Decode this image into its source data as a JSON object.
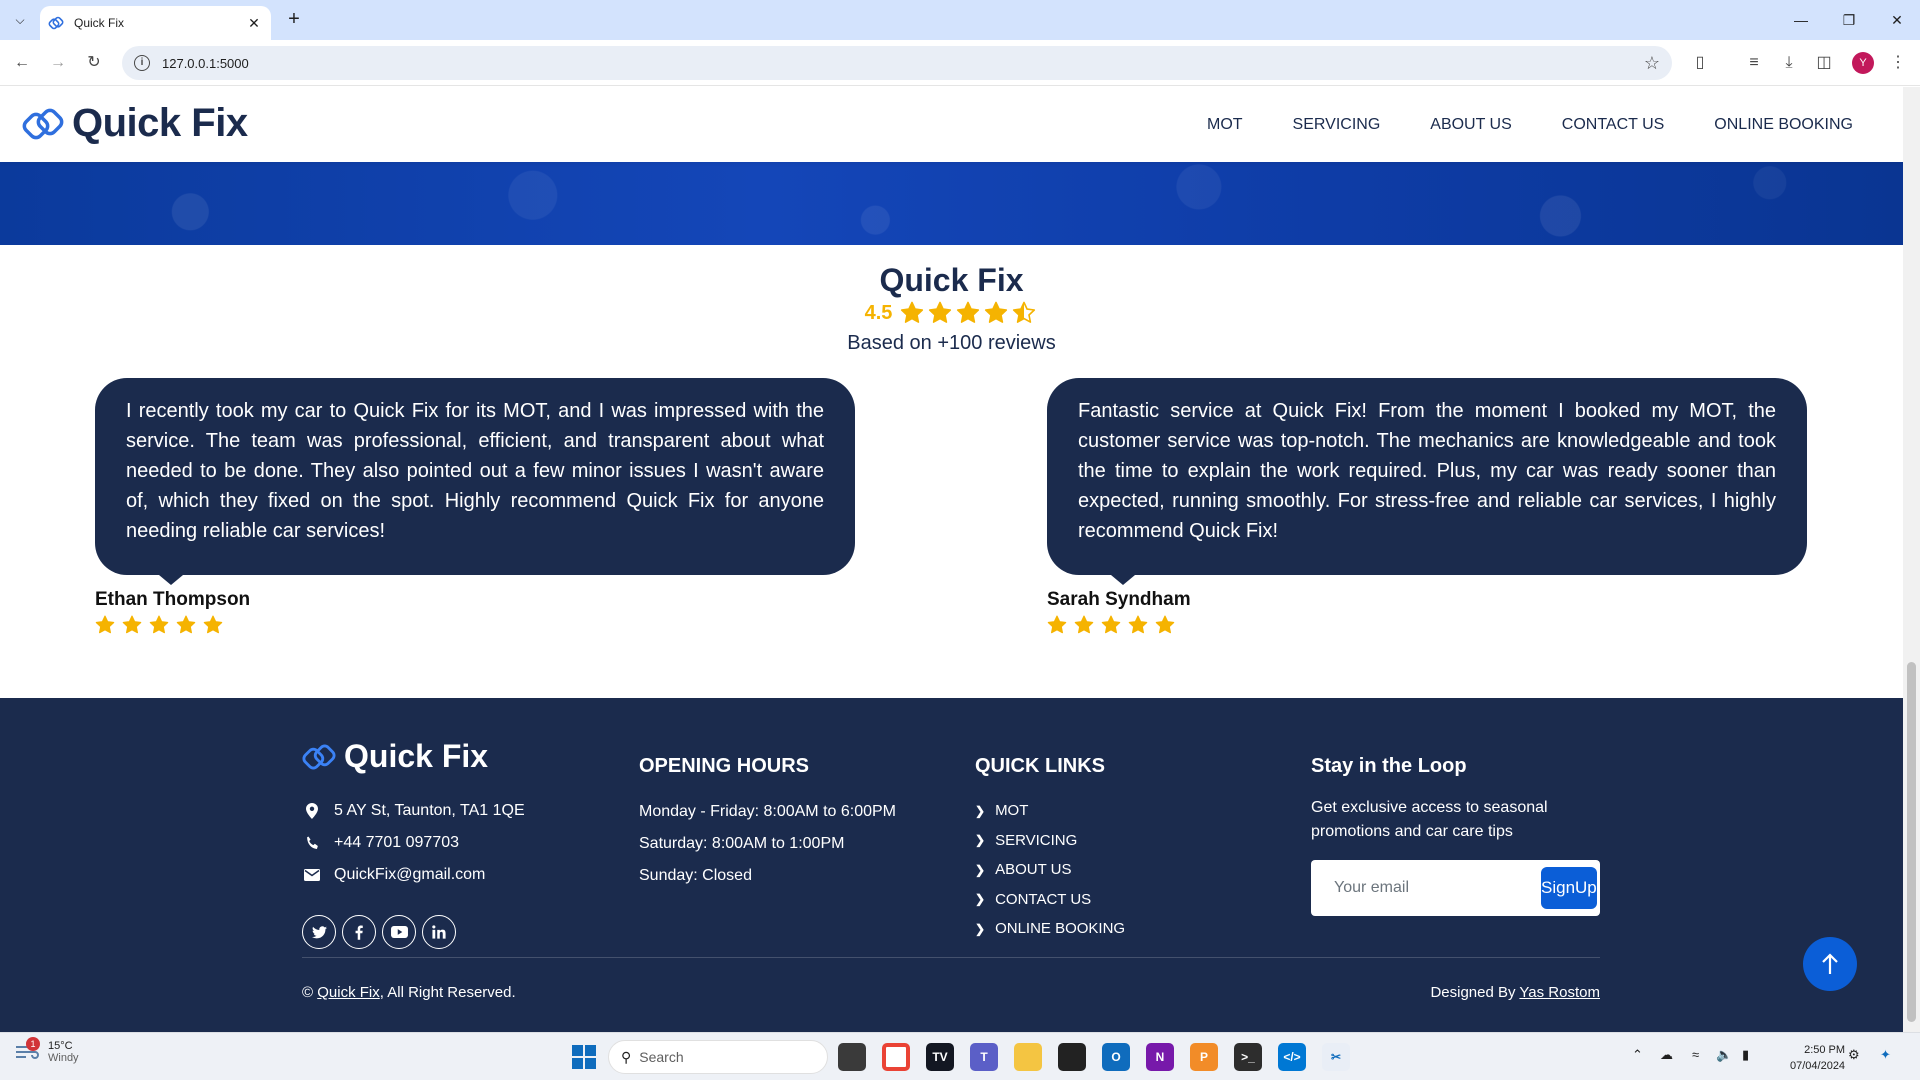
{
  "browser": {
    "tab_title": "Quick Fix",
    "url": "127.0.0.1:5000",
    "avatar_letter": "Y"
  },
  "navbar": {
    "brand": "Quick Fix",
    "links": [
      "MOT",
      "SERVICING",
      "ABOUT US",
      "CONTACT US",
      "ONLINE BOOKING"
    ]
  },
  "reviews": {
    "title": "Quick Fix",
    "rating": "4.5",
    "rating_value": 4.5,
    "rating_max": 5,
    "count_text": "Based on +100 reviews",
    "items": [
      {
        "text": "I recently took my car to Quick Fix for its MOT, and I was impressed with the service. The team was professional, efficient, and transparent about what needed to be done. They also pointed out a few minor issues I wasn't aware of, which they fixed on the spot. Highly recommend Quick Fix for anyone needing reliable car services!",
        "name": "Ethan Thompson",
        "stars": 5
      },
      {
        "text": "Fantastic service at Quick Fix! From the moment I booked my MOT, the customer service was top-notch. The mechanics are knowledgeable and took the time to explain the work required. Plus, my car was ready sooner than expected, running smoothly. For stress-free and reliable car services, I highly recommend Quick Fix!",
        "name": "Sarah Syndham",
        "stars": 5
      }
    ]
  },
  "footer": {
    "brand": "Quick Fix",
    "address": "5 AY St, Taunton, TA1 1QE",
    "phone": "+44 7701 097703",
    "email": "QuickFix@gmail.com",
    "socials": [
      "twitter-icon",
      "facebook-icon",
      "youtube-icon",
      "linkedin-icon"
    ],
    "hours_title": "OPENING HOURS",
    "hours": [
      "Monday - Friday: 8:00AM to 6:00PM",
      "Saturday: 8:00AM to 1:00PM",
      "Sunday: Closed"
    ],
    "links_title": "QUICK LINKS",
    "links": [
      "MOT",
      "SERVICING",
      "ABOUT US",
      "CONTACT US",
      "ONLINE BOOKING"
    ],
    "loop_title": "Stay in the Loop",
    "loop_text": "Get exclusive access to seasonal promotions and car care tips",
    "email_placeholder": "Your email",
    "signup_label": "SignUp",
    "copyright_prefix": "©",
    "copyright_link": "Quick Fix",
    "copyright_suffix": ", All Right Reserved.",
    "designed_prefix": "Designed By",
    "designed_link": "Yas Rostom"
  },
  "taskbar": {
    "weather_temp": "15°C",
    "weather_desc": "Windy",
    "weather_badge": "1",
    "search_placeholder": "Search",
    "time": "2:50 PM",
    "date": "07/04/2024"
  },
  "colors": {
    "navy": "#1b2b4d",
    "accent_blue": "#0b5ed7",
    "star_gold": "#f5b301"
  }
}
